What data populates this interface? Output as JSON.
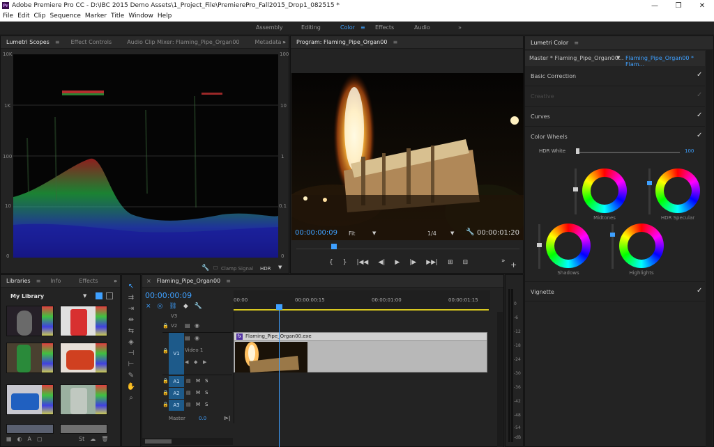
{
  "titlebar": {
    "app_icon": "Pr",
    "title": "Adobe Premiere Pro CC - D:\\IBC 2015 Demo Assets\\1_Project_File\\PremierePro_Fall2015_Drop1_082515 *",
    "minimize": "—",
    "maximize": "❐",
    "close": "✕"
  },
  "menubar": [
    "File",
    "Edit",
    "Clip",
    "Sequence",
    "Marker",
    "Title",
    "Window",
    "Help"
  ],
  "workspace": {
    "tabs": [
      "Assembly",
      "Editing",
      "Color",
      "Effects",
      "Audio"
    ],
    "active": "Color",
    "menu_icon": "≡",
    "overflow_icon": "»"
  },
  "scopes_panel": {
    "tabs": [
      "Lumetri Scopes",
      "Effect Controls",
      "Audio Clip Mixer: Flaming_Pipe_Organ00",
      "Metadata"
    ],
    "menu_icon": "≡",
    "overflow_icon": "»",
    "left_labels": [
      "10K",
      "1K",
      "100",
      "10",
      "0"
    ],
    "right_labels": [
      "100",
      "10",
      "1",
      "0.1",
      "0"
    ],
    "clamp_signal": "Clamp Signal",
    "mode": "HDR",
    "wrench_icon": "wrench-icon"
  },
  "program": {
    "title": "Program: Flaming_Pipe_Organ00",
    "menu_icon": "≡",
    "timecode_in": "00:00:00:09",
    "fit": "Fit",
    "resolution": "1/4",
    "timecode_out": "00:00:01:20",
    "transport": [
      "{",
      "}",
      "|◀◀",
      "◀|",
      "▶",
      "|▶",
      "▶▶|",
      "⊞",
      "⊟"
    ],
    "overflow_icon": "»",
    "add_icon": "+"
  },
  "lumetri": {
    "title": "Lumetri Color",
    "menu_icon": "≡",
    "master": "Master * Flaming_Pipe_Organ00...",
    "clip": "Flaming_Pipe_Organ00 * Flam...",
    "sections": [
      "Basic Correction",
      "Creative",
      "Curves",
      "Color Wheels"
    ],
    "hdr_white_label": "HDR White",
    "hdr_white_value": "100",
    "hdr_white_level": 0,
    "wheels": [
      "Midtones",
      "HDR Specular",
      "Shadows",
      "Highlights"
    ],
    "vignette": "Vignette",
    "check": "✓"
  },
  "libraries": {
    "tabs": [
      "Libraries",
      "Info",
      "Effects"
    ],
    "menu_icon": "≡",
    "overflow_icon": "»",
    "library": "My Library"
  },
  "timeline": {
    "close_icon": "×",
    "sequence": "Flaming_Pipe_Organ00",
    "menu_icon": "≡",
    "timecode": "00:00:00:09",
    "ruler": [
      "00:00",
      "00:00:00:15",
      "00:00:01:00",
      "00:00:01:15"
    ],
    "tracks_video": [
      "V3",
      "V2",
      "V1"
    ],
    "video1_name": "Video 1",
    "tracks_audio": [
      "A1",
      "A2",
      "A3"
    ],
    "master_label": "Master",
    "master_value": "0.0",
    "clip_name": "Flaming_Pipe_Organ00.exe",
    "fx_badge": "fx",
    "lock_icon": "🔒",
    "keyframe_nav": [
      "◀",
      "◆",
      "▶"
    ],
    "marker_buttons": [
      "M",
      "S"
    ]
  },
  "meter": {
    "scale": [
      "0",
      "-6",
      "-12",
      "-18",
      "-24",
      "-30",
      "-36",
      "-42",
      "-48",
      "-54",
      "-dB"
    ]
  },
  "colors": {
    "accent": "#3ea0ff",
    "panel": "#232323",
    "track": "#1d5a8a"
  }
}
